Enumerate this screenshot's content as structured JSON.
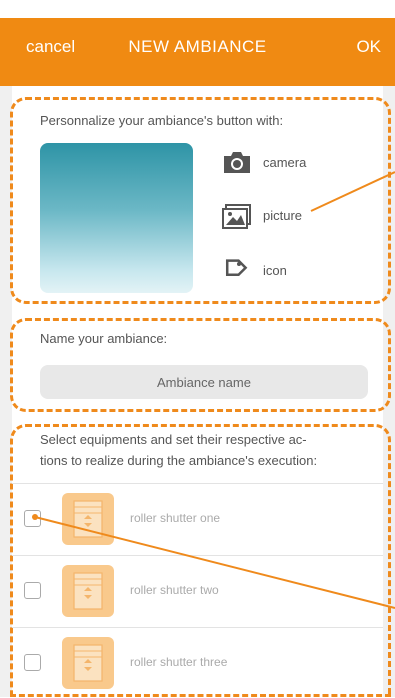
{
  "header": {
    "cancel_label": "cancel",
    "title": "NEW AMBIANCE",
    "ok_label": "OK"
  },
  "personalize": {
    "label": "Personnalize your ambiance's button with:",
    "options": [
      {
        "icon": "camera-icon",
        "label": "camera"
      },
      {
        "icon": "picture-icon",
        "label": "picture"
      },
      {
        "icon": "tag-icon",
        "label": "icon"
      }
    ]
  },
  "name_section": {
    "label": "Name your ambiance:",
    "placeholder": "Ambiance name"
  },
  "equipment_section": {
    "label_line1": "Select equipments and set their respective ac-",
    "label_line2": "tions to realize during the ambiance's execution:",
    "items": [
      {
        "icon": "roller-shutter-icon",
        "label": "roller shutter one",
        "checked": false
      },
      {
        "icon": "roller-shutter-icon",
        "label": "roller shutter two",
        "checked": false
      },
      {
        "icon": "roller-shutter-icon",
        "label": "roller shutter three",
        "checked": false
      }
    ]
  },
  "colors": {
    "accent": "#f08a12",
    "dash": "#ef8a1c",
    "preview_top": "#2e94a6",
    "preview_bottom": "#e3f3f6"
  }
}
